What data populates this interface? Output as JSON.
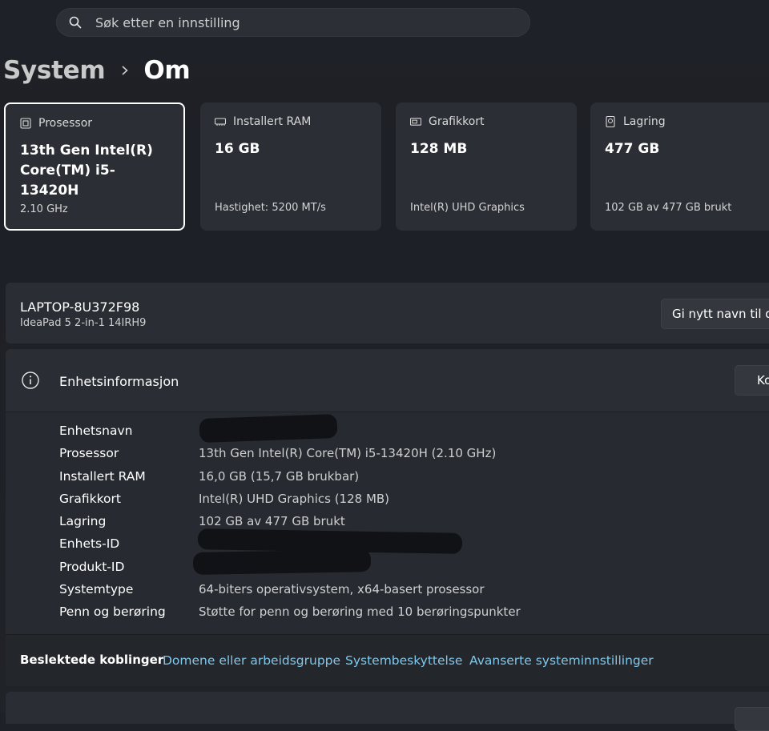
{
  "search": {
    "placeholder": "Søk etter en innstilling",
    "icon": "search-icon"
  },
  "breadcrumb": {
    "parent": "System",
    "current": "Om",
    "separator_icon": "chevron-right-icon"
  },
  "cards": [
    {
      "label": "Prosessor",
      "value": "13th Gen Intel(R) Core(TM) i5-13420H",
      "sub": "2.10 GHz",
      "icon": "cpu-icon",
      "selected": true
    },
    {
      "label": "Installert RAM",
      "value": "16 GB",
      "sub": "Hastighet: 5200 MT/s",
      "icon": "ram-icon"
    },
    {
      "label": "Grafikkort",
      "value": "128 MB",
      "sub": "Intel(R) UHD Graphics",
      "icon": "gpu-icon"
    },
    {
      "label": "Lagring",
      "value": "477 GB",
      "sub": "102 GB av 477 GB brukt",
      "icon": "storage-icon"
    }
  ],
  "device": {
    "name": "LAPTOP-8U372F98",
    "model": "IdeaPad 5 2-in-1 14IRH9",
    "rename_label": "Gi nytt navn til denne PC-en"
  },
  "info": {
    "title": "Enhetsinformasjon",
    "icon": "info-icon",
    "copy_label": "Kopier",
    "rows": [
      {
        "label": "Enhetsnavn",
        "value": ""
      },
      {
        "label": "Prosessor",
        "value": "13th Gen Intel(R) Core(TM) i5-13420H (2.10 GHz)"
      },
      {
        "label": "Installert RAM",
        "value": "16,0 GB (15,7 GB brukbar)"
      },
      {
        "label": "Grafikkort",
        "value": "Intel(R) UHD Graphics (128 MB)"
      },
      {
        "label": "Lagring",
        "value": "102 GB av 477 GB brukt"
      },
      {
        "label": "Enhets-ID",
        "value": ""
      },
      {
        "label": "Produkt-ID",
        "value": ""
      },
      {
        "label": "Systemtype",
        "value": "64-biters operativsystem, x64-basert prosessor"
      },
      {
        "label": "Penn og berøring",
        "value": "Støtte for penn og berøring med 10 berøringspunkter"
      }
    ]
  },
  "related": {
    "title": "Beslektede koblinger",
    "links": [
      "Domene eller arbeidsgruppe",
      "Systembeskyttelse",
      "Avanserte systeminnstillinger"
    ]
  },
  "colors": {
    "accent_link": "#7fc8ec",
    "background": "#1e2127",
    "card": "#2b2e34"
  }
}
